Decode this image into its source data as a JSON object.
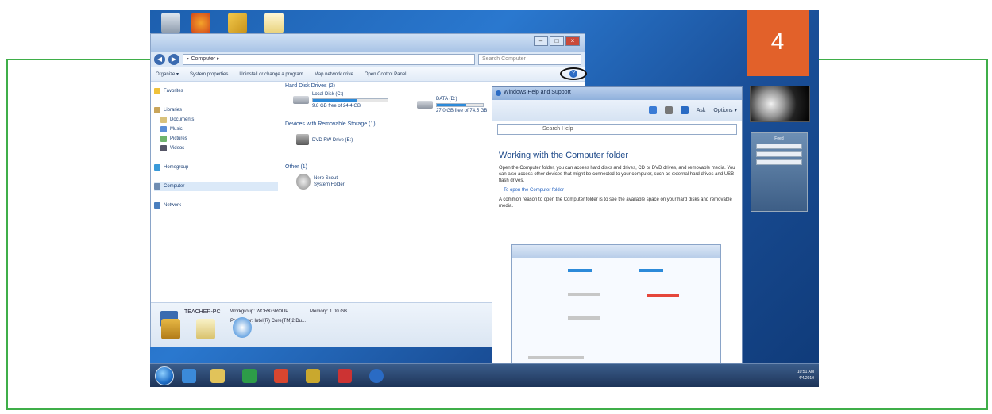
{
  "explorer": {
    "address": "▸ Computer ▸",
    "search_placeholder": "Search Computer",
    "toolbar": [
      "Organize ▾",
      "System properties",
      "Uninstall or change a program",
      "Map network drive",
      "Open Control Panel"
    ],
    "sidebar": {
      "favorites": "Favorites",
      "libraries": "Libraries",
      "library_items": [
        "Documents",
        "Music",
        "Pictures",
        "Videos"
      ],
      "homegroup": "Homegroup",
      "computer": "Computer",
      "network": "Network"
    },
    "groups": {
      "hdd": "Hard Disk Drives (2)",
      "removable": "Devices with Removable Storage (1)",
      "other": "Other (1)"
    },
    "drives": [
      {
        "name": "Local Disk (C:)",
        "free": "9.8 GB free of 24.4 GB",
        "fill": 0.6
      },
      {
        "name": "DATA (D:)",
        "free": "27.0 GB free of 74.5 GB",
        "fill": 0.64
      }
    ],
    "dvd": "DVD RW Drive (E:)",
    "other_item": {
      "name": "Nero Scout",
      "sub": "System Folder"
    },
    "details": {
      "computer_name": "TEACHER-PC",
      "domain": "Workgroup: WORKGROUP",
      "memory": "Memory: 1.00 GB",
      "processor": "Processor: Intel(R) Core(TM)2 Du..."
    }
  },
  "help": {
    "title": "Windows Help and Support",
    "search_placeholder": "Search Help",
    "toolbar_right": [
      "Ask",
      "Options ▾"
    ],
    "heading": "Working with the Computer folder",
    "para1": "Open the Computer folder, you can access hard disks and drives, CD or DVD drives, and removable media. You can also access other devices that might be connected to your computer, such as external hard drives and USB flash drives.",
    "link": "To open the Computer folder",
    "para2": "A common reason to open the Computer folder is to see the available space on your hard disks and removable media."
  },
  "gadgets": {
    "calendar_day": "4",
    "feed_title": "Feed"
  },
  "taskbar": {
    "time": "10:51 AM",
    "date": "4/4/2010"
  },
  "colors": {
    "frame": "#3fae49",
    "accent": "#2a6bc4",
    "calendar": "#e2612a"
  }
}
